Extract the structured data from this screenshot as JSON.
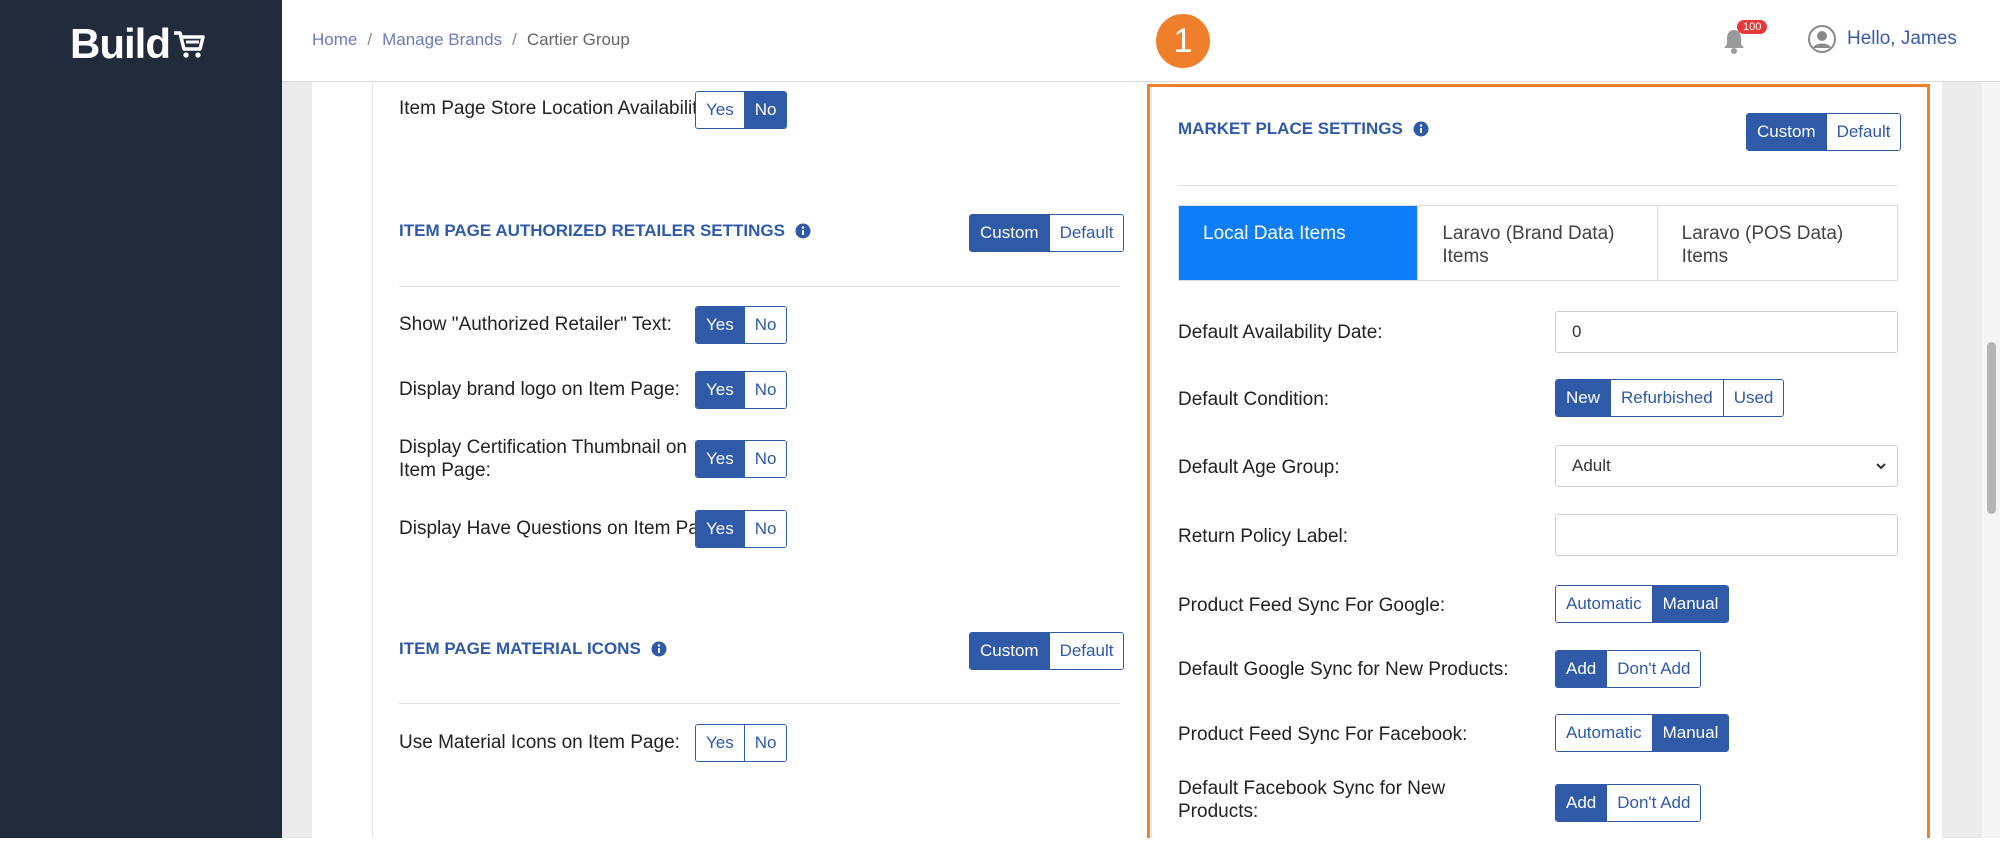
{
  "app": {
    "logo_text": "Build"
  },
  "breadcrumb": {
    "home": "Home",
    "manage_brands": "Manage Brands",
    "current": "Cartier Group"
  },
  "step_badge": "1",
  "notifications": {
    "count": "100"
  },
  "user": {
    "greeting": "Hello, James"
  },
  "left": {
    "store_location": {
      "label": "Item Page Store Location Availability:",
      "yes": "Yes",
      "no": "No",
      "selected": "No"
    },
    "retailer_section": {
      "title": "ITEM PAGE AUTHORIZED RETAILER SETTINGS",
      "custom": "Custom",
      "default": "Default",
      "selected": "Custom",
      "rows": [
        {
          "label": "Show \"Authorized Retailer\" Text:",
          "yes": "Yes",
          "no": "No",
          "selected": "Yes"
        },
        {
          "label": "Display brand logo on Item Page:",
          "yes": "Yes",
          "no": "No",
          "selected": "Yes"
        },
        {
          "label": "Display Certification Thumbnail on Item Page:",
          "yes": "Yes",
          "no": "No",
          "selected": "Yes"
        },
        {
          "label": "Display Have Questions on Item Page:",
          "yes": "Yes",
          "no": "No",
          "selected": "Yes"
        }
      ]
    },
    "material_section": {
      "title": "ITEM PAGE MATERIAL ICONS",
      "custom": "Custom",
      "default": "Default",
      "selected": "Custom",
      "row": {
        "label": "Use Material Icons on Item Page:",
        "yes": "Yes",
        "no": "No",
        "selected": "None"
      }
    }
  },
  "market": {
    "title": "MARKET PLACE SETTINGS",
    "custom": "Custom",
    "default": "Default",
    "selected": "Custom",
    "tabs": [
      "Local Data Items",
      "Laravo (Brand Data) Items",
      "Laravo (POS Data) Items"
    ],
    "active_tab": "Local Data Items",
    "availability_date": {
      "label": "Default Availability Date:",
      "value": "0"
    },
    "condition": {
      "label": "Default Condition:",
      "options": [
        "New",
        "Refurbished",
        "Used"
      ],
      "selected": "New"
    },
    "age_group": {
      "label": "Default Age Group:",
      "value": "Adult"
    },
    "return_policy": {
      "label": "Return Policy Label:",
      "value": ""
    },
    "google_sync": {
      "label": "Product Feed Sync For Google:",
      "options": [
        "Automatic",
        "Manual"
      ],
      "selected": "Manual"
    },
    "google_new": {
      "label": "Default Google Sync for New Products:",
      "options": [
        "Add",
        "Don't Add"
      ],
      "selected": "Add"
    },
    "facebook_sync": {
      "label": "Product Feed Sync For Facebook:",
      "options": [
        "Automatic",
        "Manual"
      ],
      "selected": "Manual"
    },
    "facebook_new": {
      "label": "Default Facebook Sync for New Products:",
      "options": [
        "Add",
        "Don't Add"
      ],
      "selected": "Add"
    }
  },
  "colors": {
    "sidebar": "#222b3c",
    "primary": "#2f5aa8",
    "accent": "#f07f2c",
    "active_tab": "#0d7ef7",
    "badge": "#e53a3a"
  }
}
